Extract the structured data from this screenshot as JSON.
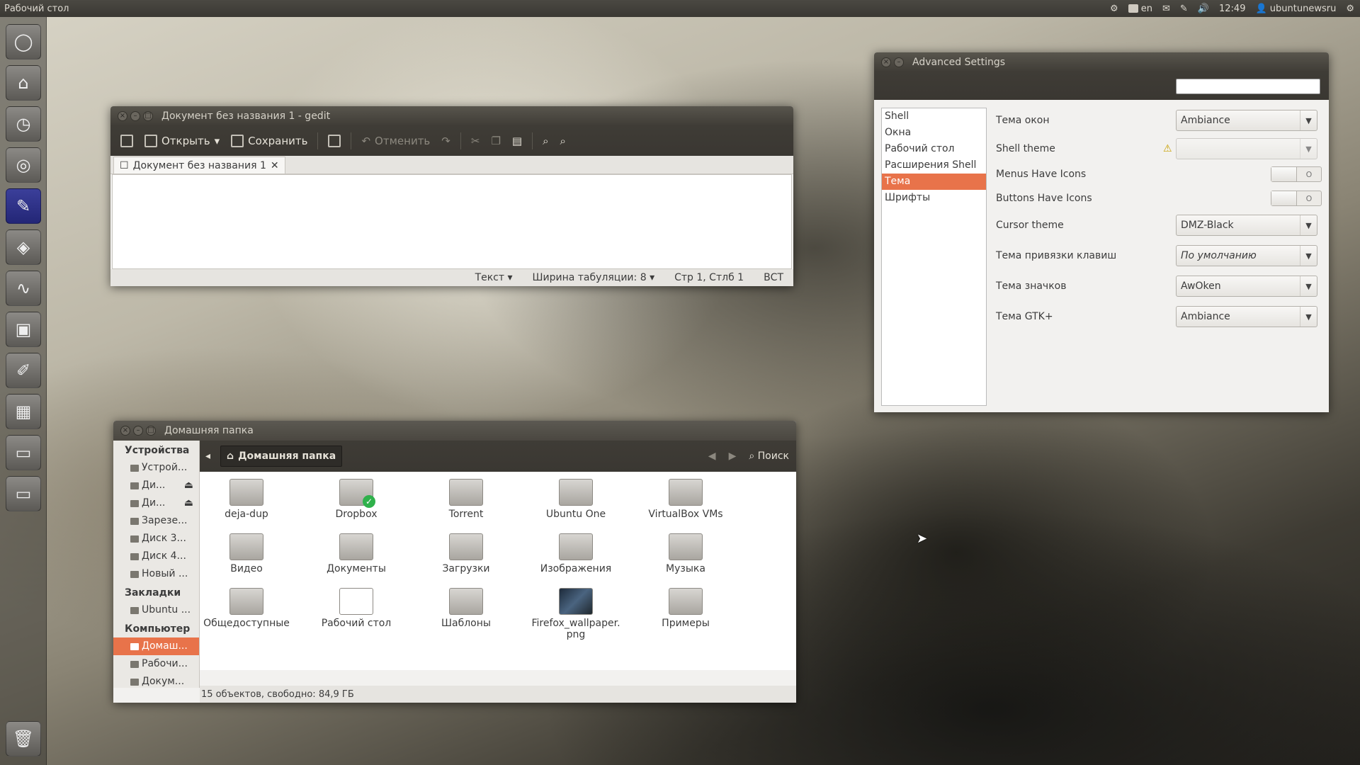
{
  "top_panel": {
    "title": "Рабочий стол",
    "keyboard_layout": "en",
    "time": "12:49",
    "user": "ubuntunewsru"
  },
  "launcher": {
    "items": [
      "dash-icon",
      "home-icon",
      "clock-icon",
      "camera-icon",
      "text-editor-icon",
      "box-icon",
      "system-monitor-icon",
      "image-viewer-icon",
      "tweak-icon",
      "layout-icon",
      "drive-icon",
      "drive-icon",
      "trash-icon"
    ]
  },
  "gedit": {
    "title": "Документ без названия 1 - gedit",
    "toolbar": {
      "open": "Открыть",
      "save": "Сохранить",
      "undo": "Отменить"
    },
    "tab_label": "Документ без названия 1",
    "status": {
      "lang": "Текст",
      "tab_width": "Ширина табуляции:",
      "tab_width_value": "8",
      "position": "Стр 1, Стлб 1",
      "mode": "ВСТ"
    }
  },
  "advanced": {
    "title": "Advanced Settings",
    "sidebar": [
      "Shell",
      "Окна",
      "Рабочий стол",
      "Расширения Shell",
      "Тема",
      "Шрифты"
    ],
    "selected_sidebar": "Тема",
    "rows": {
      "window_theme": {
        "label": "Тема окон",
        "value": "Ambiance"
      },
      "shell_theme": {
        "label": "Shell theme",
        "value": ""
      },
      "menus_icons": {
        "label": "Menus Have Icons",
        "state": "O"
      },
      "buttons_icons": {
        "label": "Buttons Have Icons",
        "state": "O"
      },
      "cursor_theme": {
        "label": "Cursor theme",
        "value": "DMZ-Black"
      },
      "keybinding_theme": {
        "label": "Тема привязки клавиш",
        "value": "По умолчанию"
      },
      "icon_theme": {
        "label": "Тема значков",
        "value": "AwOken"
      },
      "gtk_theme": {
        "label": "Тема GTK+",
        "value": "Ambiance"
      }
    }
  },
  "nautilus": {
    "title": "Домашняя папка",
    "sidebar": {
      "devices_header": "Устройства",
      "devices": [
        "Устрой...",
        "Ди...",
        "Ди...",
        "Зарезе...",
        "Диск 3...",
        "Диск 4...",
        "Новый ..."
      ],
      "bookmarks_header": "Закладки",
      "bookmarks": [
        "Ubuntu ..."
      ],
      "computer_header": "Компьютер",
      "computer": [
        "Домаш...",
        "Рабочи...",
        "Докум..."
      ]
    },
    "path": "Домашняя папка",
    "search_label": "Поиск",
    "files": [
      {
        "name": "deja-dup"
      },
      {
        "name": "Dropbox"
      },
      {
        "name": "Torrent"
      },
      {
        "name": "Ubuntu One"
      },
      {
        "name": "VirtualBox VMs"
      },
      {
        "name": "Видео"
      },
      {
        "name": "Документы"
      },
      {
        "name": "Загрузки"
      },
      {
        "name": "Изображения"
      },
      {
        "name": "Музыка"
      },
      {
        "name": "Общедоступные"
      },
      {
        "name": "Рабочий стол"
      },
      {
        "name": "Шаблоны"
      },
      {
        "name": "Firefox_wallpaper.\npng"
      },
      {
        "name": "Примеры"
      }
    ],
    "status": "15 объектов, свободно: 84,9 ГБ"
  },
  "colors": {
    "accent": "#e8734a",
    "panel": "#3c3b37"
  }
}
